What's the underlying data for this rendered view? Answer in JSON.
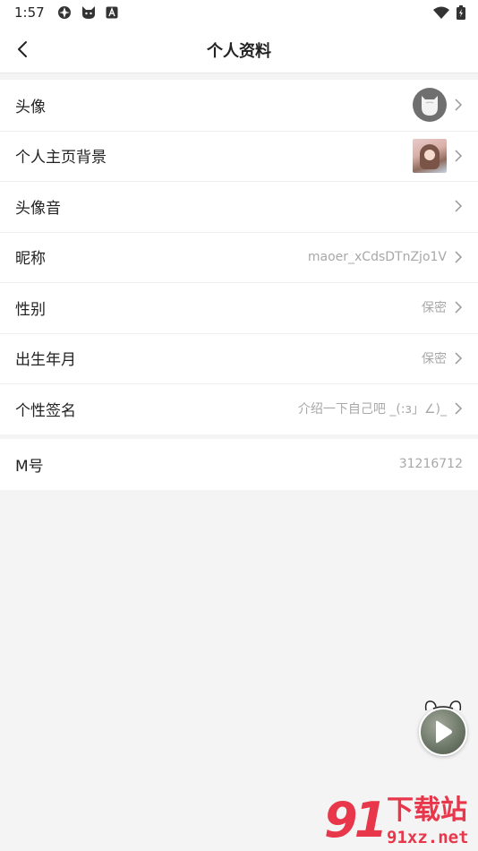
{
  "status_bar": {
    "time": "1:57",
    "left_icons": [
      "app-icon",
      "cat-icon",
      "a-box-icon"
    ],
    "right_icons": [
      "wifi-icon",
      "battery-icon"
    ]
  },
  "header": {
    "title": "个人资料",
    "back_icon": "chevron-left-icon"
  },
  "profile_rows": [
    {
      "label": "头像",
      "value": "",
      "accessory": "avatar"
    },
    {
      "label": "个人主页背景",
      "value": "",
      "accessory": "background-thumbnail"
    },
    {
      "label": "头像音",
      "value": ""
    },
    {
      "label": "昵称",
      "value": "maoer_xCdsDTnZjo1V"
    },
    {
      "label": "性别",
      "value": "保密"
    },
    {
      "label": "出生年月",
      "value": "保密"
    },
    {
      "label": "个性签名",
      "value": "介绍一下自己吧 _(:з」∠)_"
    }
  ],
  "id_row": {
    "label": "M号",
    "value": "31216712"
  },
  "floating_player": {
    "icon": "play-icon"
  },
  "watermark": {
    "number": "91",
    "brand": "下载站",
    "url": "91xz.net"
  },
  "colors": {
    "value_text": "#a8a8a8",
    "watermark": "#e8364a",
    "background": "#f4f4f4"
  }
}
